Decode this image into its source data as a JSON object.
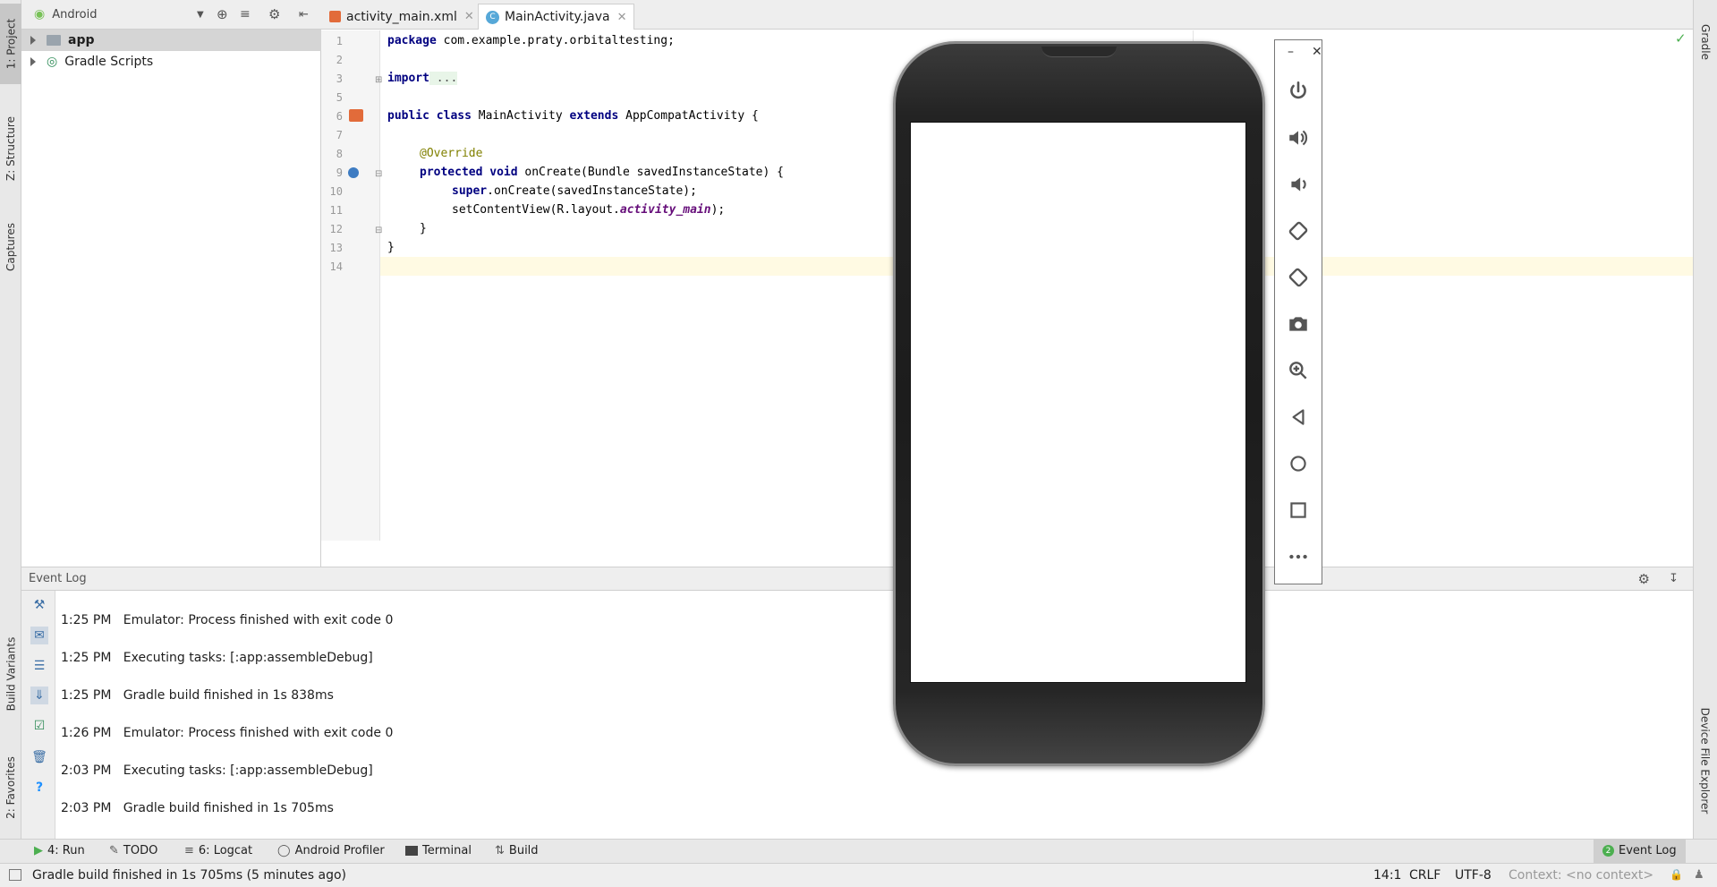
{
  "left_tabs": {
    "project": "1: Project",
    "structure": "Z: Structure",
    "captures": "Captures",
    "build_variants": "Build Variants",
    "favorites": "2: Favorites"
  },
  "right_tabs": {
    "gradle": "Gradle",
    "device_file_explorer": "Device File Explorer"
  },
  "project_panel": {
    "view_selector": "Android",
    "tree": [
      {
        "label": "app"
      },
      {
        "label": "Gradle Scripts"
      }
    ]
  },
  "editor_tabs": [
    {
      "label": "activity_main.xml",
      "icon": "xml-file-icon"
    },
    {
      "label": "MainActivity.java",
      "icon": "java-class-icon"
    }
  ],
  "code": {
    "line_numbers": [
      "1",
      "2",
      "3",
      "5",
      "6",
      "7",
      "8",
      "9",
      "10",
      "11",
      "12",
      "13",
      "14"
    ],
    "l1_kw": "package",
    "l1_rest": " com.example.praty.orbitaltesting;",
    "l3_kw": "import",
    "l3_rest": " ...",
    "l6_kw": "public class",
    "l6_name": " MainActivity ",
    "l6_kw2": "extends",
    "l6_rest": " AppCompatActivity {",
    "l8_ann": "@Override",
    "l9_kw": "protected void",
    "l9_rest": " onCreate(Bundle savedInstanceState) {",
    "l10_kw": "super",
    "l10_rest": ".onCreate(savedInstanceState);",
    "l11_a": "setContentView(R.layout.",
    "l11_b": "activity_main",
    "l11_c": ");",
    "l12": "}",
    "l13": "}"
  },
  "event_log": {
    "title": "Event Log",
    "entries": [
      {
        "time": "1:25 PM",
        "message": "Emulator: Process finished with exit code 0"
      },
      {
        "time": "1:25 PM",
        "message": "Executing tasks: [:app:assembleDebug]"
      },
      {
        "time": "1:25 PM",
        "message": "Gradle build finished in 1s 838ms"
      },
      {
        "time": "1:26 PM",
        "message": "Emulator: Process finished with exit code 0"
      },
      {
        "time": "2:03 PM",
        "message": "Executing tasks: [:app:assembleDebug]"
      },
      {
        "time": "2:03 PM",
        "message": "Gradle build finished in 1s 705ms"
      }
    ]
  },
  "bottom_tools": {
    "run": "4: Run",
    "todo": "TODO",
    "logcat": "6: Logcat",
    "profiler": "Android Profiler",
    "terminal": "Terminal",
    "build": "Build",
    "event_log": "Event Log",
    "event_log_count": "2"
  },
  "status_bar": {
    "message": "Gradle build finished in 1s 705ms (5 minutes ago)",
    "position": "14:1",
    "line_sep": "CRLF",
    "encoding": "UTF-8",
    "context": "Context: <no context>"
  },
  "emulator_controls": [
    "power-icon",
    "volume-up-icon",
    "volume-down-icon",
    "rotate-left-icon",
    "rotate-right-icon",
    "camera-icon",
    "zoom-icon",
    "back-icon",
    "home-icon",
    "overview-icon",
    "more-icon"
  ],
  "colors": {
    "accent_green": "#4caf50",
    "keyword": "#000080",
    "annotation": "#808000",
    "current_line": "#fffae3"
  }
}
